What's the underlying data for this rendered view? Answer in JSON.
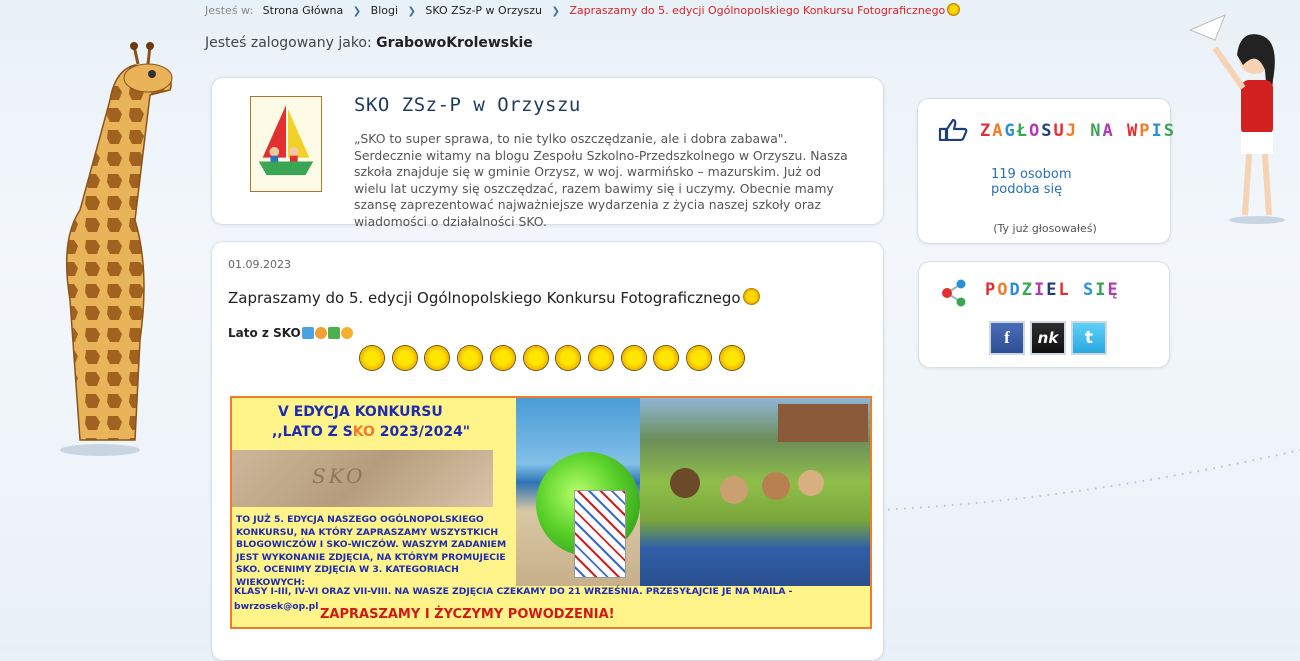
{
  "breadcrumb": {
    "prefix": "Jesteś w:",
    "items": [
      "Strona Główna",
      "Blogi",
      "SKO ZSz-P w Orzyszu"
    ],
    "current": "Zapraszamy do 5. edycji Ogólnopolskiego Konkursu Fotograficznego"
  },
  "session": {
    "label": "Jesteś zalogowany jako:",
    "user": "GrabowoKrolewskie"
  },
  "blog": {
    "title": "SKO ZSz-P w Orzyszu",
    "description": "„SKO to super sprawa, to nie tylko oszczędzanie, ale i dobra zabawa\". Serdecznie witamy na blogu Zespołu Szkolno-Przedszkolnego w Orzyszu. Nasza szkoła znajduje się w gminie Orzysz, w woj. warmińsko – mazurskim. Już od wielu lat uczymy się oszczędzać, razem bawimy się i uczymy. Obecnie mamy szansę zaprezentować najważniejsze wydarzenia z życia naszej szkoły oraz wiadomości o działalności SKO."
  },
  "post": {
    "date": "01.09.2023",
    "title": "Zapraszamy do 5. edycji Ogólnopolskiego Konkursu Fotograficznego",
    "subtitle": "Lato z SKO",
    "sun_count": 12,
    "banner": {
      "heading1": "V EDYCJA KONKURSU",
      "heading2_a": ",,LATO Z S",
      "heading2_k": "K",
      "heading2_o": "O",
      "heading2_b": " 2023/2024\"",
      "body": "TO JUŻ 5. EDYCJA NASZEGO OGÓLNOPOLSKIEGO KONKURSU, NA KTÓRY ZAPRASZAMY WSZYSTKICH BLOGOWICZÓW I SKO-WICZÓW. WASZYM ZADANIEM JEST WYKONANIE ZDJĘCIA, NA KTÓRYM PROMUJECIE SKO. OCENIMY ZDJĘCIA W 3. KATEGORIACH WIEKOWYCH:",
      "line2": "KLASY I-III, IV-VI ORAZ VII-VIII. NA WASZE ZDJĘCIA CZEKAMY DO 21 WRZEŚNIA. PRZESYŁAJCIE JE NA MAILA -",
      "email": "bwrzosek@op.pl",
      "footer": "ZAPRASZAMY I ŻYCZYMY POWODZENIA!"
    }
  },
  "vote": {
    "title": "ZAGŁOSUJ NA WPIS",
    "count_line1": "119 osobom",
    "count_line2": "podoba się",
    "note": "(Ty już głosowałeś)"
  },
  "share": {
    "title": "PODZIEL SIĘ",
    "buttons": [
      "f",
      "nk",
      "t"
    ]
  },
  "colors": {
    "accent_blue": "#2770b9",
    "breadcrumb_current": "#dd2222",
    "banner_bg": "#fff489",
    "banner_border": "#f07c2a"
  }
}
